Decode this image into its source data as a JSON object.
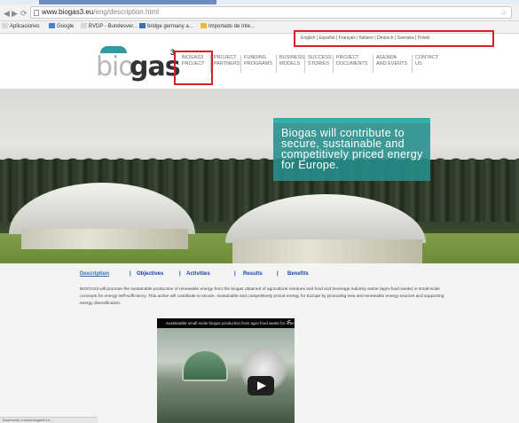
{
  "browser": {
    "url_host": "www.biogas3.eu",
    "url_path": "/eng/description.html",
    "bookmarks": [
      {
        "label": "Aplicaciones",
        "color": "#d8d8d8"
      },
      {
        "label": "Google",
        "color": "#4a7fd4"
      },
      {
        "label": "BVDP - Bundesver...",
        "color": "#d8d8d8"
      },
      {
        "label": "bridge germany a...",
        "color": "#3a6fb5"
      },
      {
        "label": "Importado de Inte...",
        "color": "#e6b93a"
      }
    ]
  },
  "site": {
    "languages": "English | Español | Français | Italiano | Deutsch | Svenska | Polski",
    "logo": {
      "bio": "bio",
      "gas": "gas",
      "sup": "3"
    },
    "nav": [
      {
        "label": "BIOGAS3\nPROJECT"
      },
      {
        "label": "PROJECT\nPARTNERS"
      },
      {
        "label": "FUNDING\nPROGRAMS"
      },
      {
        "label": "BUSINESS\nMODELS"
      },
      {
        "label": "SUCCESS\nSTORIES"
      },
      {
        "label": "PROJECT\nDOCUMENTS"
      },
      {
        "label": "AGENDA\nAND EVENTS"
      },
      {
        "label": "CONTACT\nUS"
      }
    ],
    "hero_text": "Biogas will contribute to secure, sustainable and competitively priced energy for Europe.",
    "subnav": [
      "Description",
      "Objectives",
      "Activities",
      "Results",
      "Benefits"
    ],
    "subnav_separator": "|",
    "paragraph": "BIOGAS3 will promote the sustainable production of renewable energy from the biogas obtained of agricultural residues and food and beverage industry waste (agro-food waste) in small-scale concepts for energy self-sufficiency. This action will contribute to secure, sustainable and competitively priced energy for Europe by promoting new and renewable energy sources and supporting energy diversification.",
    "video_title": "Sustainable small-scale biogas production from agro-food waste for energy self-suf..."
  },
  "status": "Esperando a www.biogas3.eu..."
}
